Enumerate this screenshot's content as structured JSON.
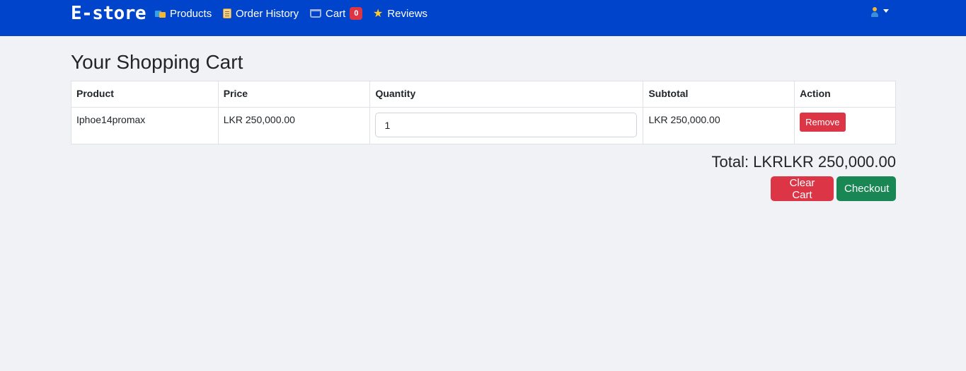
{
  "navbar": {
    "brand": "E-store",
    "items": [
      {
        "label": "Products",
        "icon": "products-icon"
      },
      {
        "label": "Order History",
        "icon": "scroll-icon"
      },
      {
        "label": "Cart",
        "icon": "cart-icon",
        "badge": "0"
      },
      {
        "label": "Reviews",
        "icon": "star-icon"
      }
    ],
    "user_icon": "user-icon"
  },
  "page": {
    "title": "Your Shopping Cart"
  },
  "cart": {
    "columns": [
      "Product",
      "Price",
      "Quantity",
      "Subtotal",
      "Action"
    ],
    "rows": [
      {
        "product": "Iphoe14promax",
        "price": "LKR 250,000.00",
        "quantity": "1",
        "subtotal": "LKR 250,000.00",
        "action": "Remove"
      }
    ],
    "total": "Total: LKRLKR 250,000.00"
  },
  "actions": {
    "clear_label": "Clear Cart",
    "checkout_label": "Checkout"
  },
  "colors": {
    "navbar": "#0044cc",
    "background": "#f1f2f5",
    "danger": "#dc3545",
    "success": "#198754"
  }
}
